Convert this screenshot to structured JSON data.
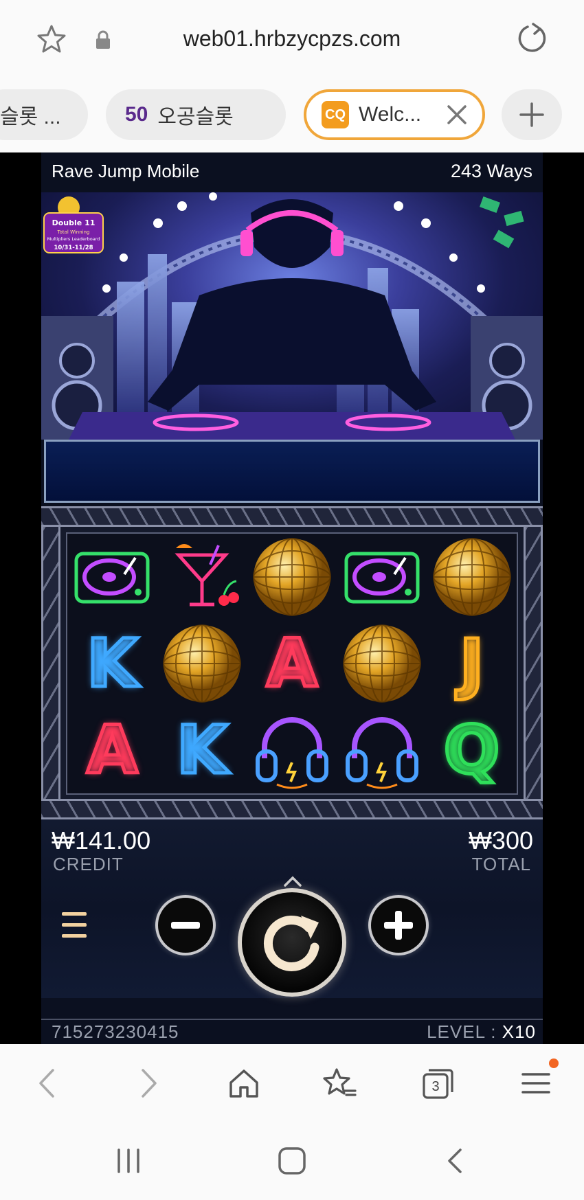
{
  "browser": {
    "url": "web01.hrbzycpzs.com",
    "tabs": [
      {
        "label": "슬롯 ..."
      },
      {
        "badge": "50",
        "label": "오공슬롯"
      },
      {
        "label": "Welc...",
        "favicon_text": "CQ",
        "active": true
      }
    ],
    "tab_count": "3"
  },
  "game": {
    "title": "Rave Jump Mobile",
    "ways": "243 Ways",
    "promo": {
      "line1": "Double 11",
      "line2": "Total Winning",
      "line3": "Multipliers Leaderboard",
      "dates": "10/31-11/28"
    },
    "reels": [
      [
        "turntable-symbol",
        "cocktail-symbol",
        "disco-ball-symbol",
        "turntable-symbol",
        "disco-ball-symbol"
      ],
      [
        "K",
        "disco-ball-symbol",
        "A",
        "disco-ball-symbol",
        "J"
      ],
      [
        "A",
        "K",
        "headphones-symbol",
        "headphones-symbol",
        "Q"
      ]
    ],
    "credit_value": "₩141.00",
    "credit_label": "CREDIT",
    "total_value": "₩300",
    "total_label": "TOTAL",
    "game_id": "715273230415",
    "level_label": "LEVEL : ",
    "level_value": "X10"
  },
  "colors": {
    "active_tab_border": "#f0a63a",
    "tab_badge": "#5a2a8c",
    "notification_dot": "#f26522"
  }
}
